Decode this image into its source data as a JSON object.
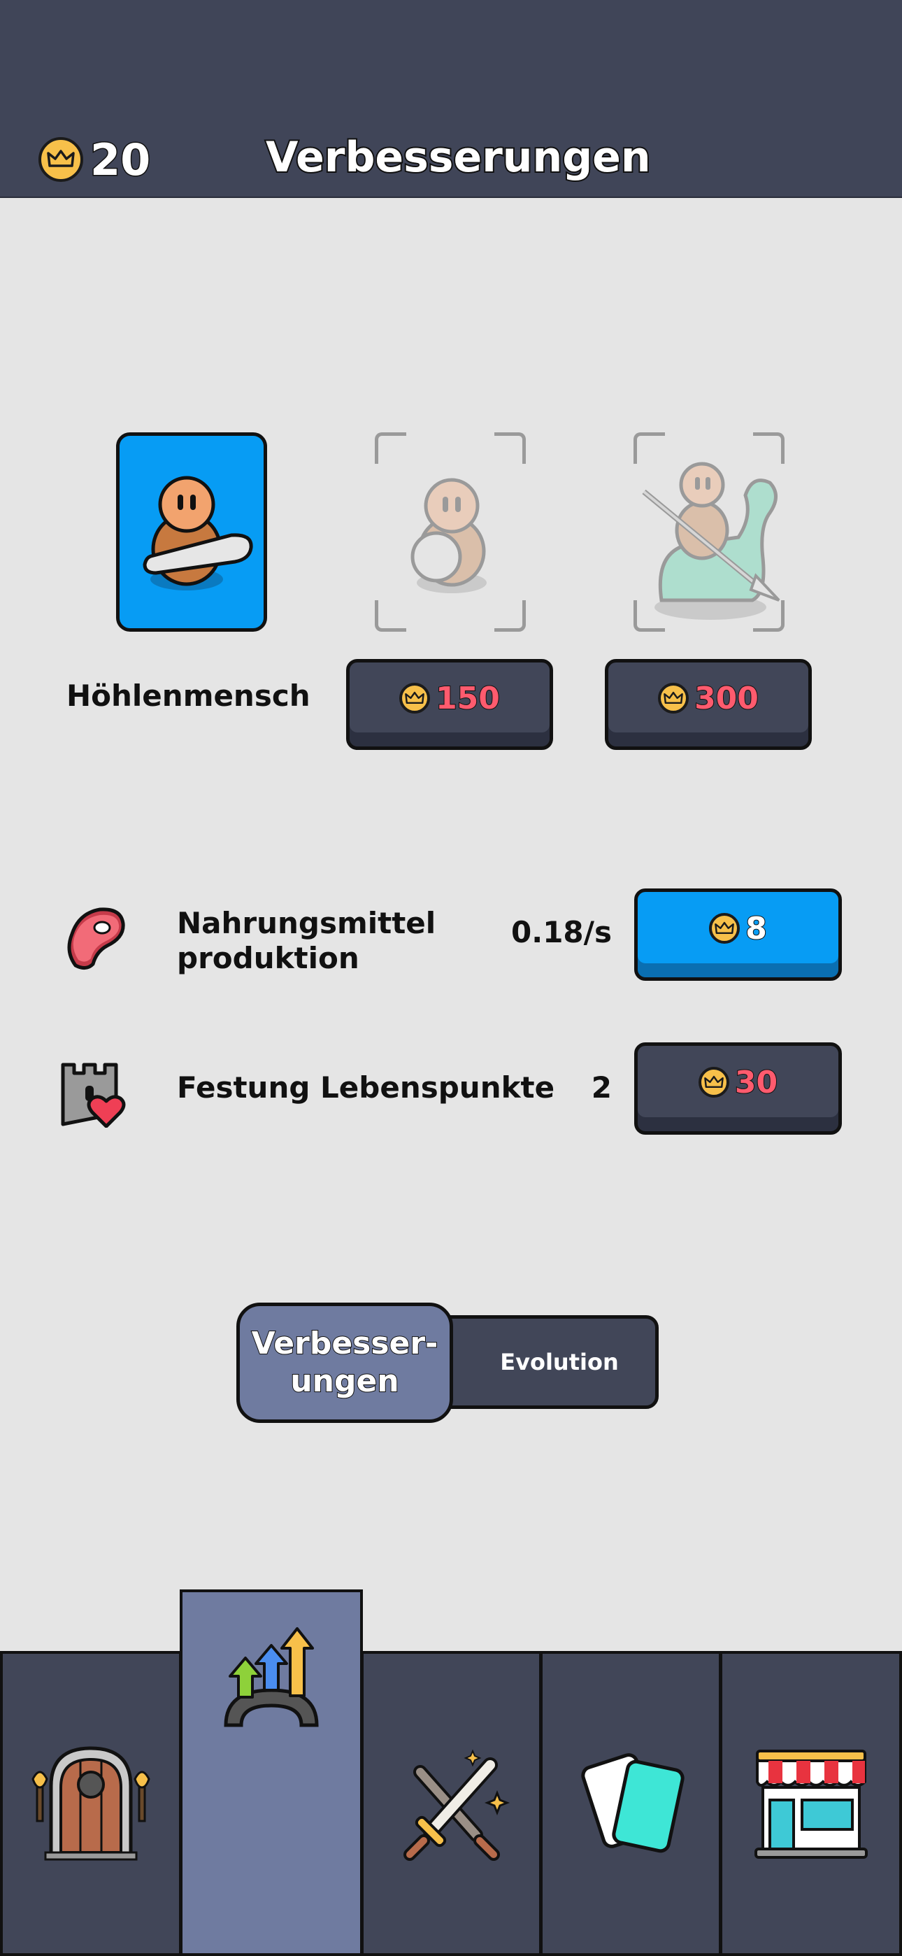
{
  "header": {
    "coin_count": "20",
    "title": "Verbesserungen",
    "coin_icon": "crown-coin-icon"
  },
  "units": [
    {
      "name": "Höhlenmensch",
      "state": "unlocked",
      "icon": "caveman-club-icon"
    },
    {
      "price": "150",
      "state": "locked",
      "icon": "caveman-shield-icon"
    },
    {
      "price": "300",
      "state": "locked",
      "icon": "dino-rider-icon"
    }
  ],
  "upgrades": [
    {
      "label_line1": "Nahrungsmittel",
      "label_line2": "produktion",
      "value": "0.18/s",
      "price": "8",
      "icon": "meat-icon"
    },
    {
      "label_line1": "Festung Lebenspunkte",
      "value": "2",
      "price": "30",
      "icon": "fortress-heart-icon"
    }
  ],
  "toggle": {
    "upgrades_line1": "Verbesser-",
    "upgrades_line2": "ungen",
    "evolution": "Evolution"
  },
  "nav": [
    {
      "icon": "castle-door-icon"
    },
    {
      "icon": "upgrade-arrows-icon",
      "active": true
    },
    {
      "icon": "crossed-swords-icon"
    },
    {
      "icon": "cards-icon"
    },
    {
      "icon": "shop-icon"
    }
  ],
  "colors": {
    "header_bg": "#404558",
    "page_bg": "#e5e5e5",
    "accent_blue": "#079cf4",
    "price_red": "#ff5b6e",
    "button_dark": "#414658",
    "nav_active": "#6f7ba0"
  }
}
